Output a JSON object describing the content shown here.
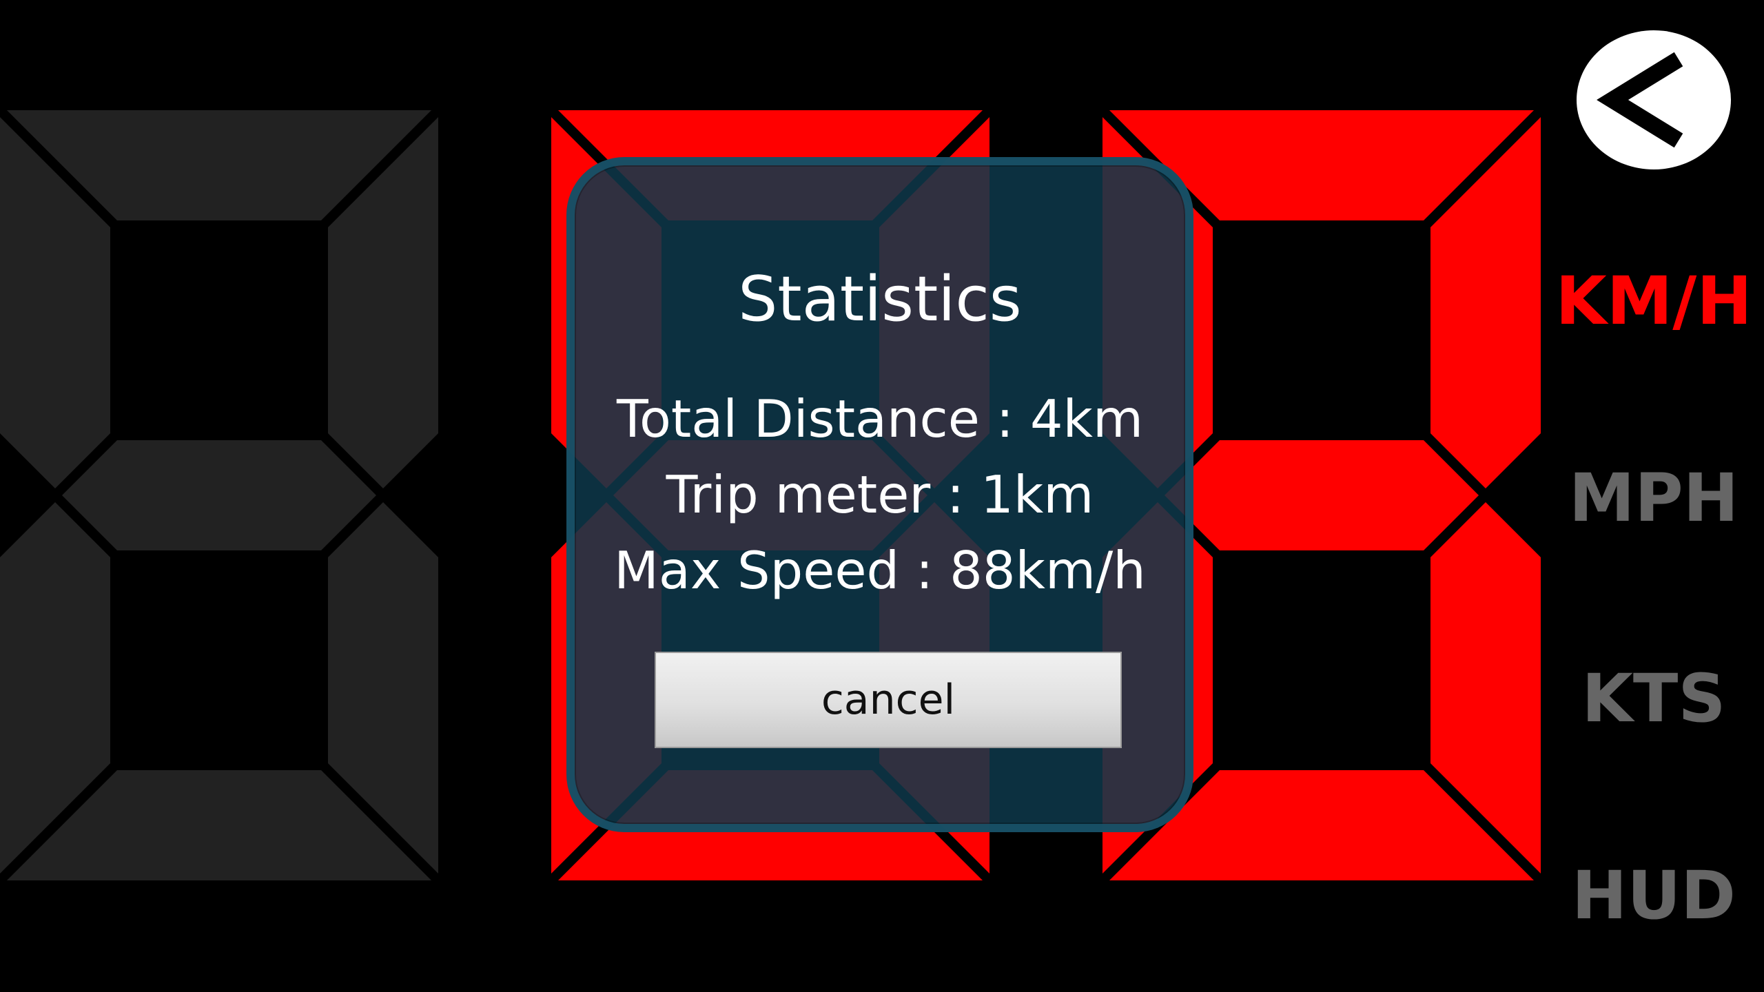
{
  "colors": {
    "segment_on": "#ff0000",
    "segment_off": "#222222",
    "unit_inactive": "#666666",
    "accent": "#ff0000"
  },
  "speed_display": {
    "digits": [
      {
        "lit": false,
        "segments_on": []
      },
      {
        "lit": true,
        "segments_on": [
          "a",
          "b",
          "c",
          "d",
          "e",
          "f",
          "g"
        ]
      },
      {
        "lit": true,
        "segments_on": [
          "a",
          "b",
          "c",
          "d",
          "e",
          "f",
          "g"
        ]
      }
    ]
  },
  "back_button": {
    "icon": "chevron-left-icon"
  },
  "units": {
    "active": "KM/H",
    "items": [
      {
        "label": "KM/H"
      },
      {
        "label": "MPH"
      },
      {
        "label": "KTS"
      },
      {
        "label": "HUD"
      }
    ]
  },
  "dialog": {
    "title": "Statistics",
    "total_distance": "Total Distance : 4km",
    "trip_meter": "Trip meter : 1km",
    "max_speed": "Max Speed : 88km/h",
    "cancel_label": "cancel"
  }
}
